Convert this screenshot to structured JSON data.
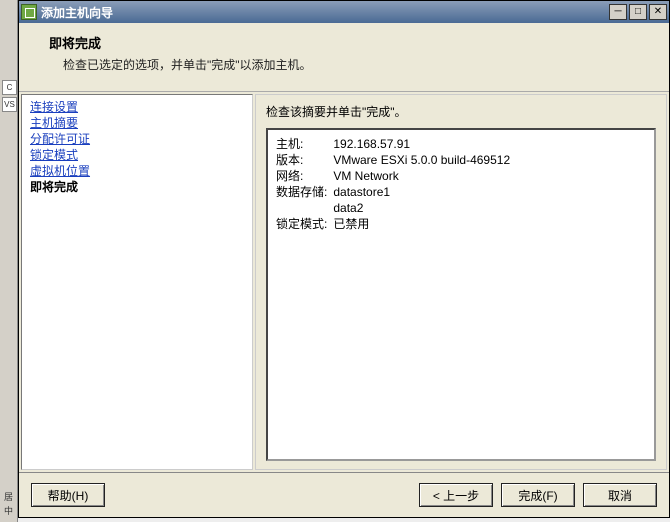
{
  "window": {
    "title": "添加主机向导"
  },
  "left_strip": {
    "slice1": "C",
    "slice2": "VS",
    "btm1": "居",
    "btm2": "中"
  },
  "header": {
    "step_title": "即将完成",
    "step_desc": "检查已选定的选项，并单击\"完成\"以添加主机。"
  },
  "nav": {
    "items": [
      {
        "label": "连接设置",
        "current": false
      },
      {
        "label": "主机摘要",
        "current": false
      },
      {
        "label": "分配许可证",
        "current": false
      },
      {
        "label": "锁定模式",
        "current": false
      },
      {
        "label": "虚拟机位置",
        "current": false
      },
      {
        "label": "即将完成",
        "current": true
      }
    ]
  },
  "content": {
    "instruction": "检查该摘要并单击\"完成\"。"
  },
  "summary": {
    "host_label": "主机:",
    "host_value": "192.168.57.91",
    "version_label": "版本:",
    "version_value": "VMware ESXi 5.0.0 build-469512",
    "network_label": "网络:",
    "network_value": "VM Network",
    "datastore_label": "数据存储:",
    "datastore_value1": "datastore1",
    "datastore_value2": "data2",
    "lock_label": "锁定模式:",
    "lock_value": "已禁用"
  },
  "footer": {
    "help": "帮助(H)",
    "back": "< 上一步",
    "finish": "完成(F)",
    "cancel": "取消"
  }
}
